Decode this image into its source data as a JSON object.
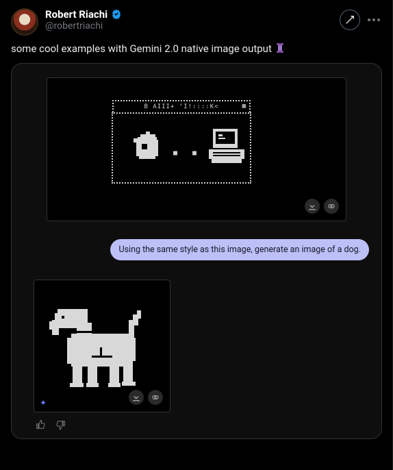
{
  "author": {
    "display_name": "Robert Riachi",
    "handle": "@robertriachi",
    "verified": true
  },
  "tweet_text": "some cool examples with Gemini 2.0 native image output",
  "thread_emoji": "🧵",
  "chat": {
    "panel1_label": "native-image-output-1",
    "panel1_header_text": "B AIII+ ‘I!::::K<",
    "prompt_text": "Using the same style as this image, generate an image of a dog.",
    "panel2_label": "dog-image-output",
    "actions": {
      "download": "Download",
      "copy": "Copy"
    },
    "feedback": {
      "like": "Like",
      "dislike": "Dislike"
    }
  },
  "top_actions": {
    "grok": "Grok",
    "more": "More"
  }
}
